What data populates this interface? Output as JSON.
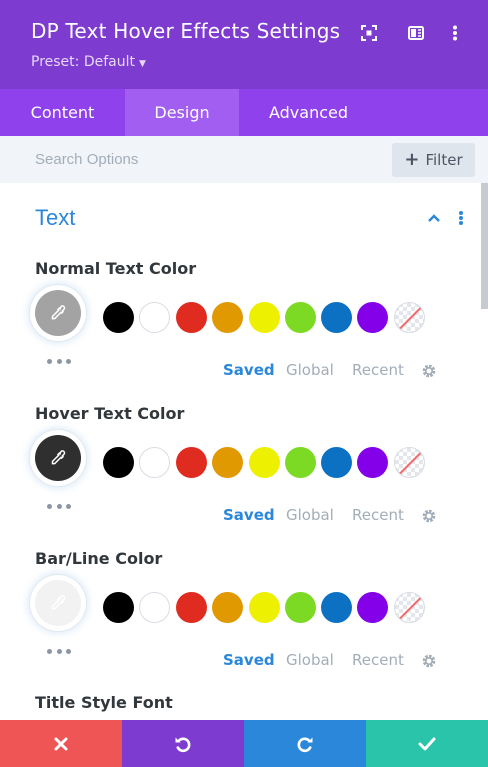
{
  "header": {
    "title": "DP Text Hover Effects Settings",
    "preset": "Preset: Default",
    "icons": [
      "fullscreen-icon",
      "sidebar-icon",
      "more-vertical-icon"
    ]
  },
  "tabs": [
    "Content",
    "Design",
    "Advanced"
  ],
  "active_tab": "Design",
  "search": {
    "placeholder": "Search Options",
    "filter_label": "Filter"
  },
  "section": {
    "title": "Text"
  },
  "fields": [
    {
      "label": "Normal Text Color",
      "value_color": "#a3a3a3"
    },
    {
      "label": "Hover Text Color",
      "value_color": "#2f2f2f"
    },
    {
      "label": "Bar/Line Color",
      "value_color": "#f2f2f2"
    }
  ],
  "palette": {
    "colors": [
      "#000000",
      "#ffffff",
      "#e02b20",
      "#e09900",
      "#edf000",
      "#7cda24",
      "#0c71c3",
      "#8300e9"
    ],
    "tabs": [
      "Saved",
      "Global",
      "Recent"
    ],
    "active": "Saved"
  },
  "next_field_label": "Title Style Font",
  "footer": {
    "buttons": [
      "close",
      "undo",
      "redo",
      "save"
    ],
    "colors": [
      "#ef5555",
      "#7d3bcf",
      "#2b87da",
      "#29c4a9"
    ]
  },
  "theme": {
    "accent": "#2b87da",
    "header_bg": "#7e3bd0",
    "tab_bg": "#8f42ec"
  }
}
